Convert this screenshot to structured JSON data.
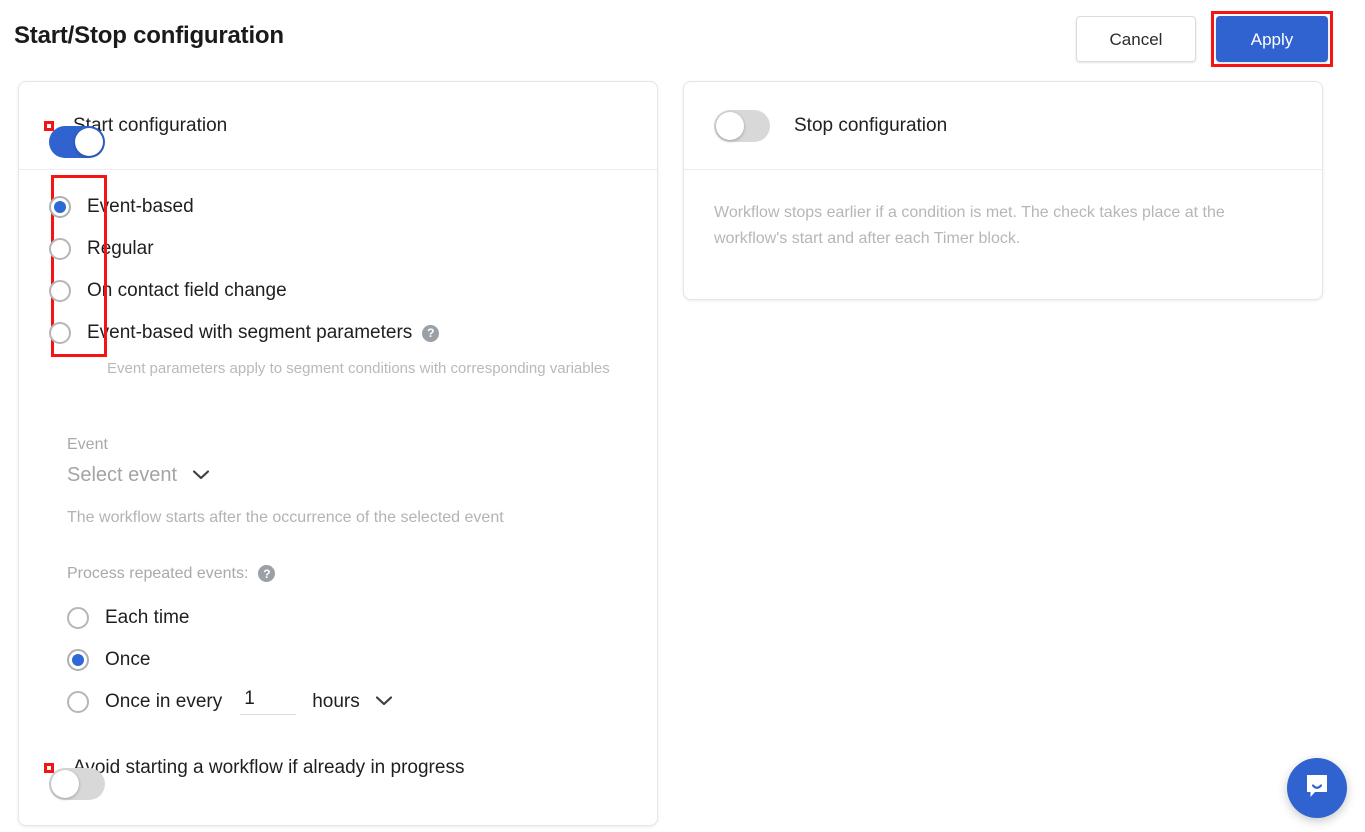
{
  "header": {
    "title": "Start/Stop configuration",
    "cancel_label": "Cancel",
    "apply_label": "Apply"
  },
  "start_card": {
    "toggle_label": "Start configuration",
    "toggle_state": "on",
    "trigger_options": [
      {
        "label": "Event-based",
        "selected": true
      },
      {
        "label": "Regular",
        "selected": false
      },
      {
        "label": "On contact field change",
        "selected": false
      },
      {
        "label": "Event-based with segment parameters",
        "selected": false,
        "help": "?"
      }
    ],
    "segment_hint": "Event parameters apply to segment conditions with corresponding variables",
    "event": {
      "label": "Event",
      "select_value": "Select event",
      "chevron": "chevron-down",
      "description": "The workflow starts after the occurrence of the selected event"
    },
    "repeat": {
      "label": "Process repeated events:",
      "help": "?",
      "options": [
        {
          "label": "Each time",
          "selected": false
        },
        {
          "label": "Once",
          "selected": true
        },
        {
          "label": "Once in every",
          "selected": false
        }
      ],
      "interval_value": "1",
      "interval_unit": "hours",
      "unit_chevron": "chevron-down"
    },
    "avoid_toggle": {
      "label": "Avoid starting a workflow if already in progress",
      "state": "off"
    }
  },
  "stop_card": {
    "toggle_label": "Stop configuration",
    "toggle_state": "off",
    "body_text": "Workflow stops earlier if a condition is met. The check takes place at the workflow's start and after each Timer block."
  },
  "chat": {
    "icon": "chat-bubble-icon"
  },
  "colors": {
    "accent_blue": "#3063d0",
    "annotation_red": "#f41414",
    "muted_text": "#b3b3b3"
  }
}
